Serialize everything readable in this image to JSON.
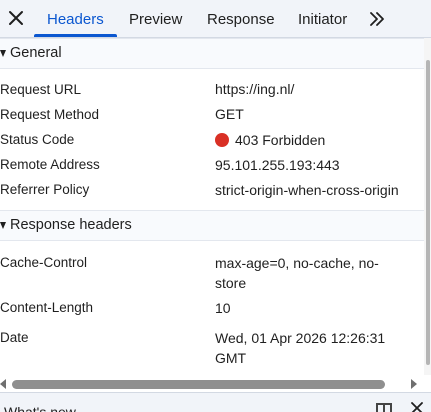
{
  "tabs": {
    "close_label": "",
    "items": [
      "Headers",
      "Preview",
      "Response",
      "Initiator"
    ],
    "active": "Headers",
    "accent_color": "#0b57d0",
    "overflow_icon": "chevron-double-right-icon"
  },
  "general": {
    "title": "General",
    "rows": [
      {
        "key": "Request URL",
        "value": "https://ing.nl/"
      },
      {
        "key": "Request Method",
        "value": "GET"
      },
      {
        "key": "Status Code",
        "value": "403 Forbidden",
        "status_color": "#d93025"
      },
      {
        "key": "Remote Address",
        "value": "95.101.255.193:443"
      },
      {
        "key": "Referrer Policy",
        "value": "strict-origin-when-cross-origin"
      }
    ]
  },
  "response_headers": {
    "title": "Response headers",
    "rows": [
      {
        "key": "Cache-Control",
        "value_line1": "max-age=0, no-cache, no-",
        "value_line2": "store"
      },
      {
        "key": "Content-Length",
        "value_line1": "10"
      },
      {
        "key": "Date",
        "value_line1": "Wed, 01 Apr 2026 12:26:31",
        "value_line2": "GMT"
      }
    ]
  },
  "drawer": {
    "title": "What's new"
  }
}
